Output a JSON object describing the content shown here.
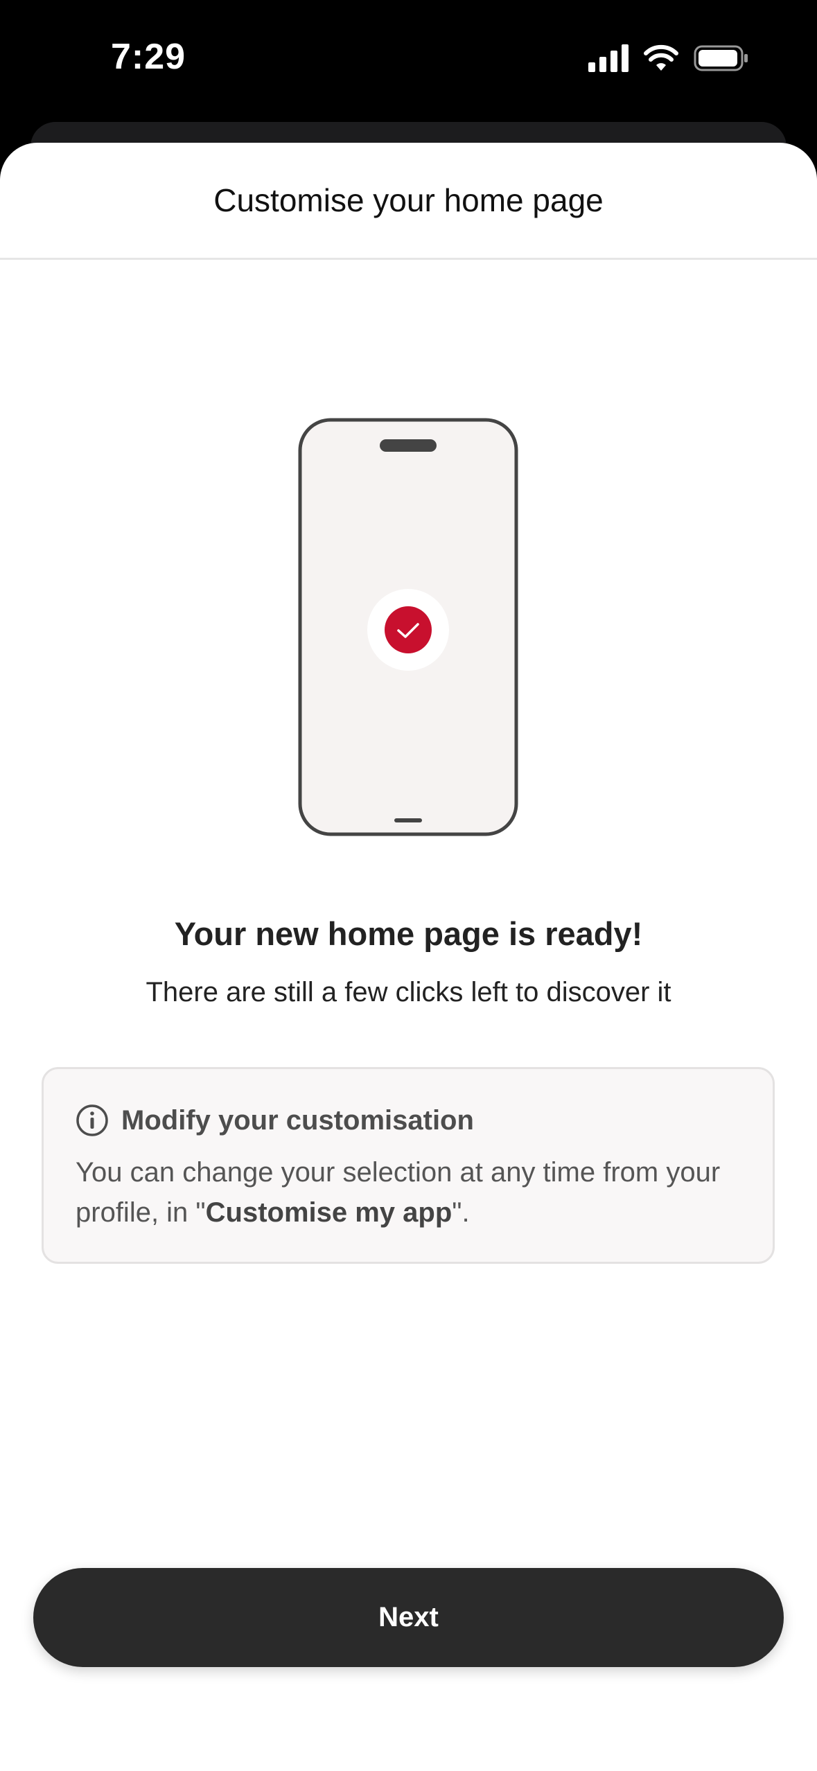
{
  "status_bar": {
    "time": "7:29",
    "icons": [
      "signal-icon",
      "wifi-icon",
      "battery-icon"
    ]
  },
  "sheet": {
    "title": "Customise your home page"
  },
  "illustration": {
    "icon": "phone-check-illustration",
    "accent_color": "#c8102e"
  },
  "main": {
    "headline": "Your new home page is ready!",
    "subtext": "There are still a few clicks left to discover it"
  },
  "info_card": {
    "icon": "info-icon",
    "title": "Modify your customisation",
    "body_prefix": "You can change your selection at any time from your profile, in \"",
    "body_bold": "Customise my app",
    "body_suffix": "\"."
  },
  "footer": {
    "next_label": "Next"
  }
}
